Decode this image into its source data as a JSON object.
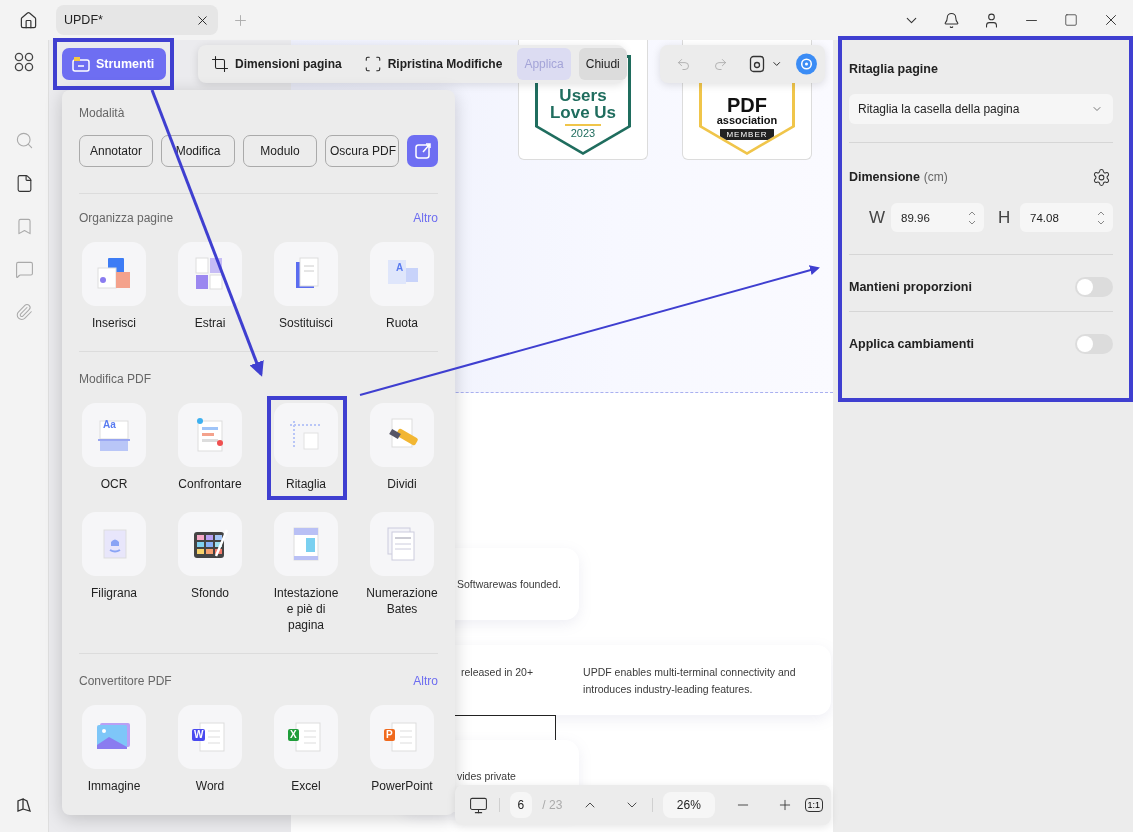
{
  "title_bar": {
    "tab": {
      "title": "UPDF*"
    }
  },
  "tools_button": {
    "label": "Strumenti",
    "selected": true
  },
  "crop_toolbar": {
    "buttons": [
      {
        "kind": "page-size",
        "label": "Dimensioni pagina",
        "disabled": false
      },
      {
        "kind": "reset",
        "label": "Ripristina Modifiche",
        "disabled": false
      },
      {
        "kind": "text",
        "label": "Applica",
        "disabled": true
      },
      {
        "kind": "text",
        "label": "Chiudi",
        "disabled": false
      }
    ]
  },
  "document": {
    "badges": [
      {
        "kind": "shield",
        "lines": [
          "Users",
          "Love Us"
        ],
        "caption": "2023"
      },
      {
        "kind": "member",
        "lines": [
          "PDF",
          "association"
        ],
        "caption": "MEMBER"
      }
    ],
    "cards": [
      {
        "kind": "single",
        "texts": [
          "Softwarewas founded."
        ]
      },
      {
        "kind": "split",
        "texts": [
          "released in 20+",
          "UPDF enables multi-terminal connectivity and introduces industry-leading features."
        ]
      },
      {
        "kind": "outline"
      },
      {
        "kind": "single",
        "texts": [
          "vides private"
        ]
      }
    ]
  },
  "tools_menu": {
    "modes": {
      "title": "Modalità",
      "buttons": [
        "Annotator",
        "Modifica",
        "Modulo",
        "Oscura PDF"
      ]
    },
    "sections": [
      {
        "title": "Organizza pagine",
        "more": "Altro",
        "items": [
          {
            "kind": "insert",
            "label": "Inserisci"
          },
          {
            "kind": "extract",
            "label": "Estrai"
          },
          {
            "kind": "replace",
            "label": "Sostituisci"
          },
          {
            "kind": "rotate",
            "label": "Ruota",
            "icon_text": "A"
          }
        ]
      },
      {
        "title": "Modifica PDF",
        "items": [
          {
            "kind": "ocr",
            "label": "OCR",
            "icon_text": "Aa"
          },
          {
            "kind": "compare",
            "label": "Confrontare"
          },
          {
            "kind": "crop",
            "label": "Ritaglia"
          },
          {
            "kind": "split",
            "label": "Dividi"
          },
          {
            "kind": "watermark",
            "label": "Filigrana"
          },
          {
            "kind": "background",
            "label": "Sfondo"
          },
          {
            "kind": "header",
            "label": "Intestazione e piè di pagina"
          },
          {
            "kind": "bates",
            "label": "Numerazione Bates"
          }
        ]
      },
      {
        "title": "Convertitore PDF",
        "more": "Altro",
        "items": [
          {
            "kind": "image",
            "label": "Immagine"
          },
          {
            "kind": "word",
            "label": "Word",
            "icon_text": "W"
          },
          {
            "kind": "excel",
            "label": "Excel",
            "icon_text": "X"
          },
          {
            "kind": "powerpoint",
            "label": "PowerPoint",
            "icon_text": "P"
          }
        ]
      }
    ]
  },
  "page_nav": {
    "page": "6",
    "total": "/ 23",
    "zoom": "26%",
    "actual_size": "1:1"
  },
  "crop_panel": {
    "title": "Ritaglia pagine",
    "select": {
      "value": "Ritaglia la casella della pagina"
    },
    "dimension": {
      "label": "Dimensione",
      "unit": "(cm)",
      "fields": [
        {
          "label": "W",
          "value": "89.96"
        },
        {
          "label": "H",
          "value": "74.08"
        }
      ]
    },
    "toggles": [
      {
        "label": "Mantieni proporzioni",
        "on": false
      },
      {
        "label": "Applica cambiamenti",
        "on": false
      }
    ]
  }
}
